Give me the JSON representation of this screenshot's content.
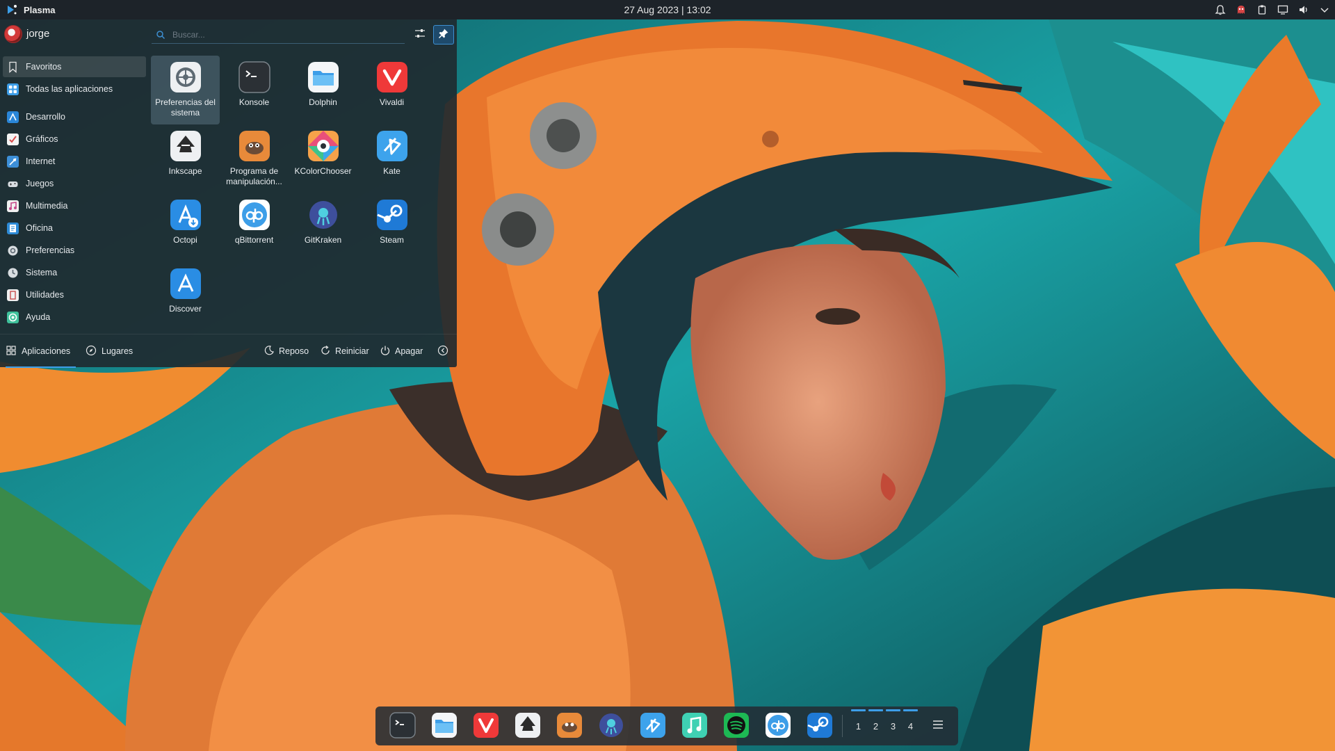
{
  "topbar": {
    "app_name": "Plasma",
    "clock": "27 Aug 2023 | 13:02",
    "tray_icons": [
      "notifications-icon",
      "ghost-icon",
      "clipboard-icon",
      "display-icon",
      "volume-icon",
      "chevron-down-icon"
    ]
  },
  "launcher": {
    "user_name": "jorge",
    "search": {
      "placeholder": "Buscar...",
      "value": ""
    },
    "categories": [
      {
        "label": "Favoritos",
        "icon": "bookmark-icon",
        "color": "#3a3f44"
      },
      {
        "label": "Todas las aplicaciones",
        "icon": "grid-icon",
        "color": "#3d9ee8"
      },
      {
        "label": "Desarrollo",
        "icon": "development-icon",
        "color": "#2a86d8"
      },
      {
        "label": "Gráficos",
        "icon": "graphics-icon",
        "color": "#d94c4c"
      },
      {
        "label": "Internet",
        "icon": "internet-icon",
        "color": "#3d8fd8"
      },
      {
        "label": "Juegos",
        "icon": "games-icon",
        "color": "#6c7780"
      },
      {
        "label": "Multimedia",
        "icon": "multimedia-icon",
        "color": "#c54a8c"
      },
      {
        "label": "Oficina",
        "icon": "office-icon",
        "color": "#2e8bd6"
      },
      {
        "label": "Preferencias",
        "icon": "preferences-icon",
        "color": "#5a6670"
      },
      {
        "label": "Sistema",
        "icon": "system-icon",
        "color": "#5a6670"
      },
      {
        "label": "Utilidades",
        "icon": "utilities-icon",
        "color": "#c94d4d"
      },
      {
        "label": "Ayuda",
        "icon": "help-icon",
        "color": "#3fc19b"
      }
    ],
    "apps": [
      {
        "label": "Preferencias del sistema",
        "icon": "system-settings-icon"
      },
      {
        "label": "Konsole",
        "icon": "konsole-icon"
      },
      {
        "label": "Dolphin",
        "icon": "dolphin-icon"
      },
      {
        "label": "Vivaldi",
        "icon": "vivaldi-icon"
      },
      {
        "label": "Inkscape",
        "icon": "inkscape-icon"
      },
      {
        "label": "Programa de manipulación...",
        "icon": "gimp-icon"
      },
      {
        "label": "KColorChooser",
        "icon": "kcolorchooser-icon"
      },
      {
        "label": "Kate",
        "icon": "kate-icon"
      },
      {
        "label": "Octopi",
        "icon": "octopi-icon"
      },
      {
        "label": "qBittorrent",
        "icon": "qbittorrent-icon"
      },
      {
        "label": "GitKraken",
        "icon": "gitkraken-icon"
      },
      {
        "label": "Steam",
        "icon": "steam-icon"
      },
      {
        "label": "Discover",
        "icon": "discover-icon"
      }
    ],
    "footer": {
      "tab_apps": "Aplicaciones",
      "tab_places": "Lugares",
      "sleep": "Reposo",
      "restart": "Reiniciar",
      "shutdown": "Apagar"
    }
  },
  "dock": {
    "apps": [
      "konsole-icon",
      "dolphin-icon",
      "vivaldi-icon",
      "inkscape-icon",
      "gimp-icon",
      "gitkraken-icon",
      "kate-icon",
      "music-icon",
      "spotify-icon",
      "qbittorrent-icon",
      "steam-icon"
    ],
    "desktops": [
      "1",
      "2",
      "3",
      "4"
    ]
  },
  "colors": {
    "accent": "#3d9ee8",
    "panel": "#1d2329",
    "launcher_bg": "#1f2a30"
  }
}
